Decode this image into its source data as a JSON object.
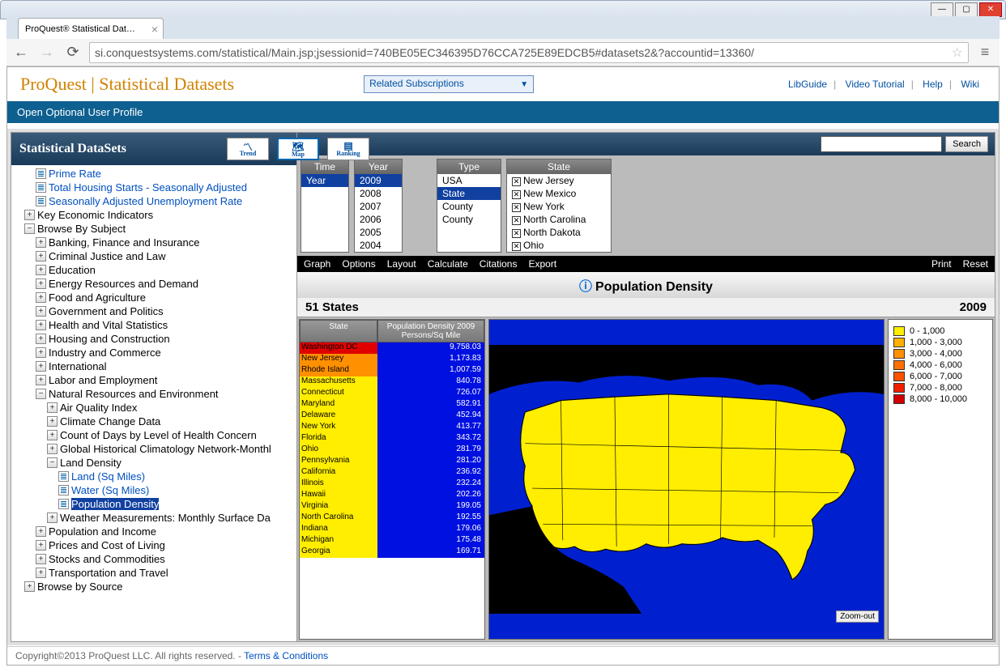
{
  "window": {
    "tab_title": "ProQuest® Statistical Dat…"
  },
  "url": "si.conquestsystems.com/statistical/Main.jsp;jsessionid=740BE05EC346395D76CCA725E89EDCB5#datasets2&?accountid=13360/",
  "header": {
    "brand": "ProQuest | Statistical Datasets",
    "subs": "Related Subscriptions",
    "links": {
      "libguide": "LibGuide",
      "video": "Video Tutorial",
      "help": "Help",
      "wiki": "Wiki"
    }
  },
  "bluebar": "Open Optional User Profile",
  "ds_title": "Statistical DataSets",
  "modes": {
    "trend": "Trend",
    "map": "Map",
    "ranking": "Ranking"
  },
  "search": {
    "placeholder": "",
    "button": "Search"
  },
  "tree": {
    "top": [
      "Prime Rate",
      "Total Housing Starts - Seasonally Adjusted",
      "Seasonally Adjusted Unemployment Rate"
    ],
    "key_econ": "Key Economic Indicators",
    "browse_subj": "Browse By Subject",
    "subjects": [
      "Banking, Finance and Insurance",
      "Criminal Justice and Law",
      "Education",
      "Energy Resources and Demand",
      "Food and Agriculture",
      "Government and Politics",
      "Health and Vital Statistics",
      "Housing and Construction",
      "Industry and Commerce",
      "International",
      "Labor and Employment",
      "Natural Resources and Environment"
    ],
    "nre_children": [
      "Air Quality Index",
      "Climate Change Data",
      "Count of Days by Level of Health Concern",
      "Global Historical Climatology Network-Monthl",
      "Land Density"
    ],
    "land_density": [
      "Land (Sq Miles)",
      "Water (Sq Miles)",
      "Population Density"
    ],
    "after_nre": [
      "Weather Measurements: Monthly Surface Da"
    ],
    "subjects2": [
      "Population and Income",
      "Prices and Cost of Living",
      "Stocks and Commodities",
      "Transportation and Travel"
    ],
    "browse_src": "Browse by Source"
  },
  "selectors": {
    "time": {
      "header": "Time",
      "item": "Year"
    },
    "year": {
      "header": "Year",
      "items": [
        "2009",
        "2008",
        "2007",
        "2006",
        "2005",
        "2004"
      ],
      "active": "2009"
    },
    "type": {
      "header": "Type",
      "items": [
        "USA",
        "State",
        "County",
        "County"
      ],
      "active": "State"
    },
    "state": {
      "header": "State",
      "items": [
        "New Jersey",
        "New Mexico",
        "New York",
        "North Carolina",
        "North Dakota",
        "Ohio"
      ]
    }
  },
  "menubar": [
    "Graph",
    "Options",
    "Layout",
    "Calculate",
    "Citations",
    "Export"
  ],
  "menubar_right": [
    "Print",
    "Reset"
  ],
  "vis": {
    "title": "Population Density",
    "left": "51 States",
    "right": "2009"
  },
  "chart_data": {
    "type": "table",
    "title": "Population Density 2009",
    "unit": "Persons/Sq Mile",
    "col_state": "State",
    "col_val": "Population Density 2009",
    "rows": [
      {
        "state": "Washington DC",
        "v": "9,758.03",
        "c": "#e00000"
      },
      {
        "state": "New Jersey",
        "v": "1,173.83",
        "c": "#ff9000"
      },
      {
        "state": "Rhode Island",
        "v": "1,007.59",
        "c": "#ff9000"
      },
      {
        "state": "Massachusetts",
        "v": "840.78",
        "c": "#ffee00"
      },
      {
        "state": "Connecticut",
        "v": "726.07",
        "c": "#ffee00"
      },
      {
        "state": "Maryland",
        "v": "582.91",
        "c": "#ffee00"
      },
      {
        "state": "Delaware",
        "v": "452.94",
        "c": "#ffee00"
      },
      {
        "state": "New York",
        "v": "413.77",
        "c": "#ffee00"
      },
      {
        "state": "Florida",
        "v": "343.72",
        "c": "#ffee00"
      },
      {
        "state": "Ohio",
        "v": "281.79",
        "c": "#ffee00"
      },
      {
        "state": "Pennsylvania",
        "v": "281.20",
        "c": "#ffee00"
      },
      {
        "state": "California",
        "v": "236.92",
        "c": "#ffee00"
      },
      {
        "state": "Illinois",
        "v": "232.24",
        "c": "#ffee00"
      },
      {
        "state": "Hawaii",
        "v": "202.26",
        "c": "#ffee00"
      },
      {
        "state": "Virginia",
        "v": "199.05",
        "c": "#ffee00"
      },
      {
        "state": "North Carolina",
        "v": "192.55",
        "c": "#ffee00"
      },
      {
        "state": "Indiana",
        "v": "179.06",
        "c": "#ffee00"
      },
      {
        "state": "Michigan",
        "v": "175.48",
        "c": "#ffee00"
      },
      {
        "state": "Georgia",
        "v": "169.71",
        "c": "#ffee00"
      }
    ],
    "legend": [
      {
        "label": "0 - 1,000",
        "c": "#ffee00"
      },
      {
        "label": "1,000 - 3,000",
        "c": "#ffb000"
      },
      {
        "label": "3,000 - 4,000",
        "c": "#ff9000"
      },
      {
        "label": "4,000 - 6,000",
        "c": "#ff7000"
      },
      {
        "label": "6,000 - 7,000",
        "c": "#ff5000"
      },
      {
        "label": "7,000 - 8,000",
        "c": "#f02000"
      },
      {
        "label": "8,000 - 10,000",
        "c": "#d00000"
      }
    ]
  },
  "zoom": "Zoom-out",
  "footer": {
    "copy": "Copyright©2013 ProQuest LLC. All rights reserved. - ",
    "terms": "Terms & Conditions"
  }
}
